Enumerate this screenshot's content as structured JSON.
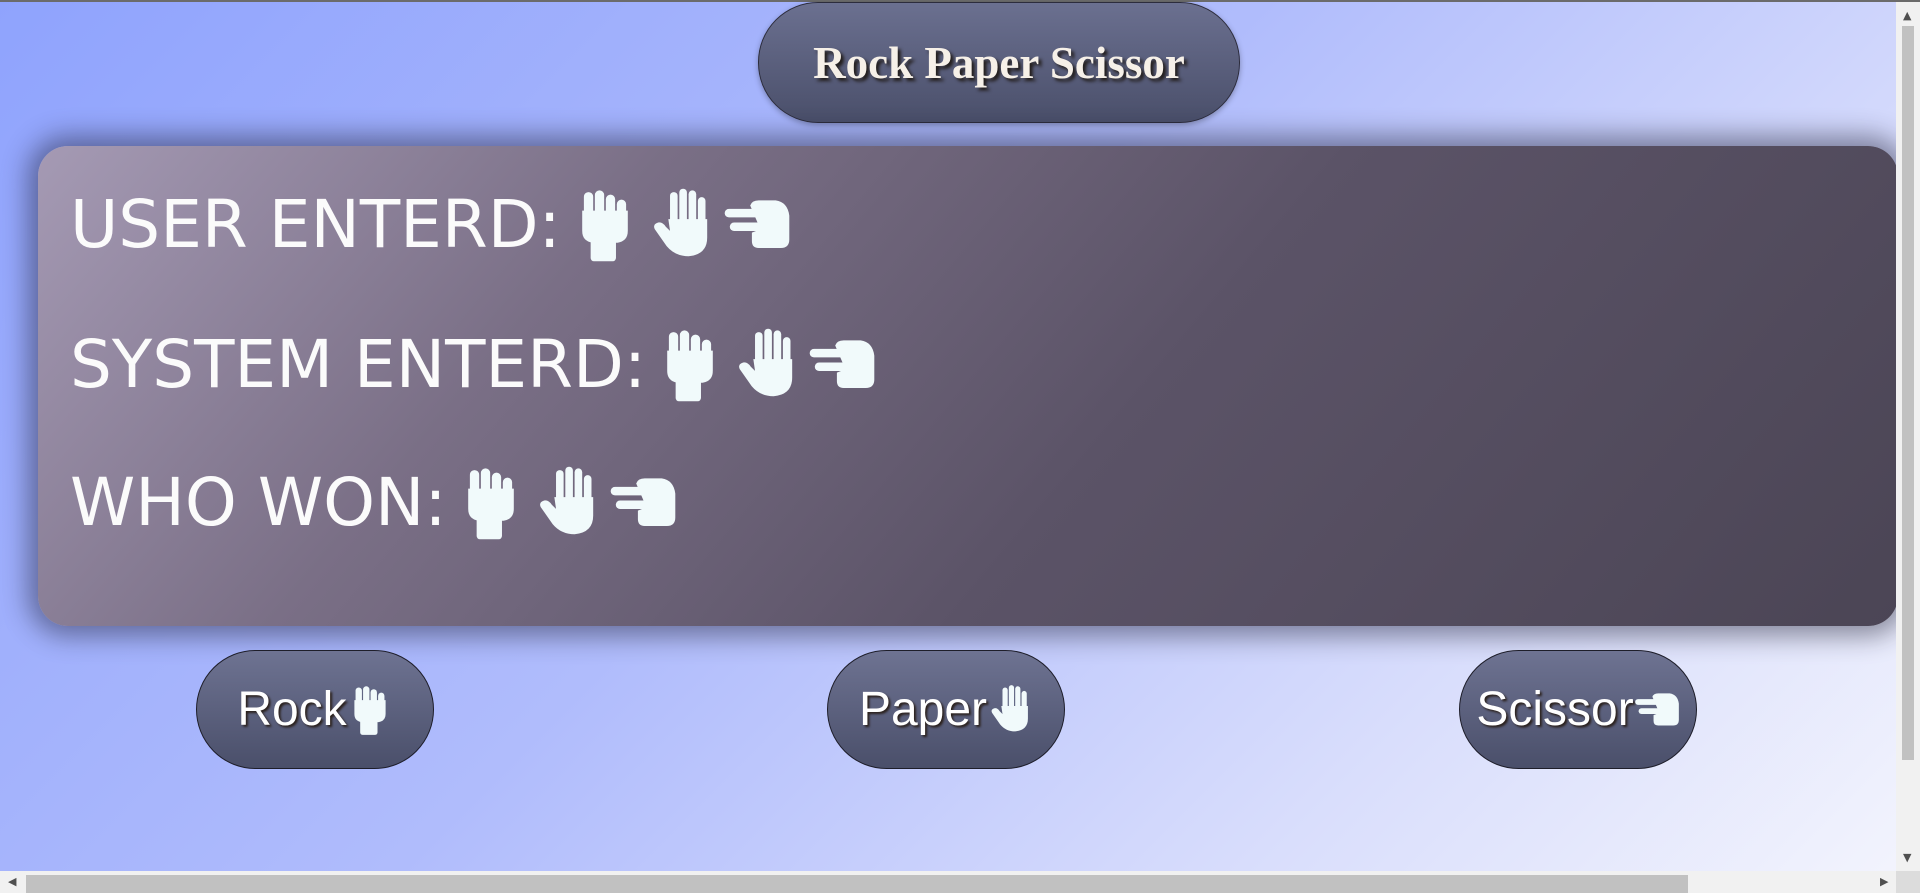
{
  "title": "Rock Paper Scissor",
  "panel": {
    "user_label": "USER ENTERD:",
    "system_label": "SYSTEM ENTERD:",
    "winner_label": "WHO WON:"
  },
  "icons": [
    "fist-icon",
    "raised-hand-icon",
    "pointing-right-icon"
  ],
  "buttons": {
    "rock_label": "Rock",
    "paper_label": "Paper",
    "scissor_label": "Scissor"
  },
  "colors": {
    "icon_fill": "#f1fafb",
    "button_fill": "#555a75",
    "panel_dark": "#4b4555"
  }
}
